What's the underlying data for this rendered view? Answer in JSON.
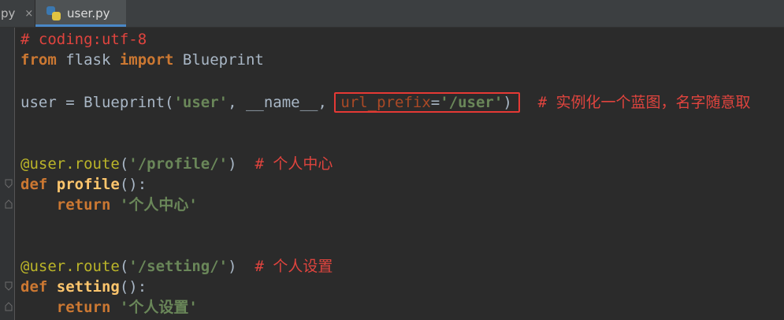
{
  "tabs": [
    {
      "label": "py",
      "close": "×",
      "active": false
    },
    {
      "label": "user.py",
      "active": true
    }
  ],
  "code": {
    "l1": {
      "comment": "# coding:utf-8"
    },
    "l2": {
      "kw1": "from",
      "mod": " flask ",
      "kw2": "import",
      "name": " Blueprint"
    },
    "l4": {
      "pre": "user = Blueprint(",
      "s1": "'user'",
      "mid": ", __name__, ",
      "kwarg": "url_prefix",
      "eq": "=",
      "s2": "'/user'",
      "close": ")",
      "cmt_hash": "  # ",
      "cmt_text": "实例化一个蓝图，名字随意取"
    },
    "l7": {
      "dec": "@user.route",
      "open": "(",
      "s": "'/profile/'",
      "close": ")",
      "cmt_hash": "  # ",
      "cmt_text": "个人中心"
    },
    "l8": {
      "kw": "def",
      "fn": " profile",
      "rest": "():"
    },
    "l9": {
      "indent": "    ",
      "kw": "return",
      "sp": " ",
      "q1": "'",
      "s": "个人中心",
      "q2": "'"
    },
    "l12": {
      "dec": "@user.route",
      "open": "(",
      "s": "'/setting/'",
      "close": ")",
      "cmt_hash": "  # ",
      "cmt_text": "个人设置"
    },
    "l13": {
      "kw": "def",
      "fn": " setting",
      "rest": "():"
    },
    "l14": {
      "indent": "    ",
      "kw": "return",
      "sp": " ",
      "q1": "'",
      "s": "个人设置",
      "q2": "'"
    }
  },
  "colors": {
    "background": "#2b2b2b",
    "keyword": "#cc7832",
    "string": "#6a8759",
    "comment": "#e0443e",
    "highlight_box": "#e53935",
    "tab_underline": "#4a88c7"
  }
}
